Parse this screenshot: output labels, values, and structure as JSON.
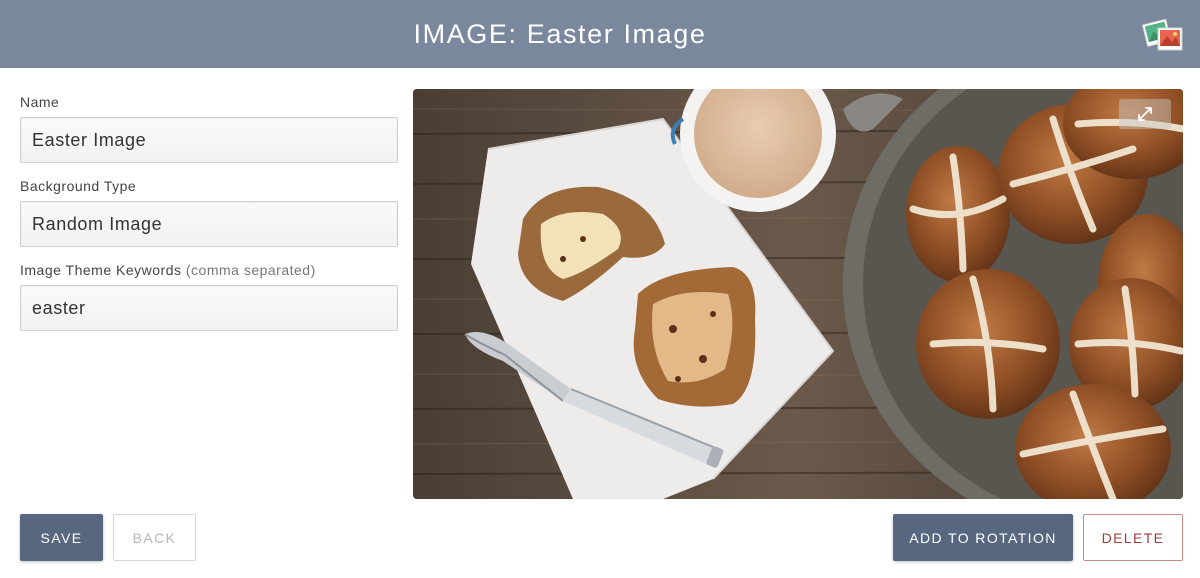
{
  "header": {
    "title": "IMAGE: Easter Image",
    "icon": "photos-icon"
  },
  "form": {
    "name": {
      "label": "Name",
      "value": "Easter Image"
    },
    "background_type": {
      "label": "Background Type",
      "value": "Random Image"
    },
    "keywords": {
      "label": "Image Theme Keywords",
      "hint": "(comma separated)",
      "value": "easter"
    }
  },
  "preview": {
    "expand_icon": "expand-icon"
  },
  "actions": {
    "save": "SAVE",
    "back": "BACK",
    "add_to_rotation": "ADD TO ROTATION",
    "delete": "DELETE"
  },
  "colors": {
    "header_bg": "#7a889e",
    "primary_button": "#57677f",
    "delete_text": "#9b3e3e"
  }
}
